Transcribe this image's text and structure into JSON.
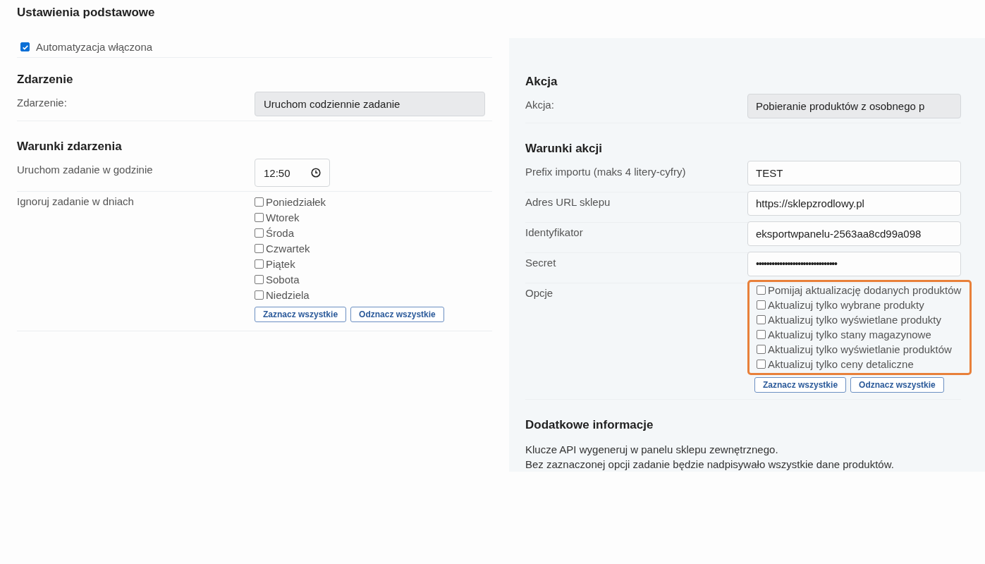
{
  "title": "Ustawienia podstawowe",
  "automation": {
    "label": "Automatyzacja włączona",
    "checked": true
  },
  "event": {
    "heading": "Zdarzenie",
    "label": "Zdarzenie:",
    "value": "Uruchom codziennie zadanie"
  },
  "event_conditions": {
    "heading": "Warunki zdarzenia",
    "time": {
      "label": "Uruchom zadanie w godzinie",
      "value": "12:50"
    },
    "ignore_days": {
      "label": "Ignoruj zadanie w dniach",
      "days": [
        {
          "label": "Poniedziałek",
          "checked": false
        },
        {
          "label": "Wtorek",
          "checked": false
        },
        {
          "label": "Środa",
          "checked": false
        },
        {
          "label": "Czwartek",
          "checked": false
        },
        {
          "label": "Piątek",
          "checked": false
        },
        {
          "label": "Sobota",
          "checked": false
        },
        {
          "label": "Niedziela",
          "checked": false
        }
      ],
      "buttons": [
        "Zaznacz wszystkie",
        "Odznacz wszystkie"
      ]
    }
  },
  "action": {
    "heading": "Akcja",
    "label": "Akcja:",
    "value": "Pobieranie produktów z osobnego p"
  },
  "action_conditions": {
    "heading": "Warunki akcji",
    "fields": [
      {
        "label": "Prefix importu (maks 4 litery-cyfry)",
        "value": "TEST"
      },
      {
        "label": "Adres URL sklepu",
        "value": "https://sklepzrodlowy.pl"
      },
      {
        "label": "Identyfikator",
        "value": "eksportwpanelu-2563aa8cd99a098"
      },
      {
        "label": "Secret",
        "value": "•••••••••••••••••••••••••••••••"
      }
    ],
    "options": {
      "label": "Opcje",
      "highlighted": true,
      "items": [
        {
          "label": "Pomijaj aktualizację dodanych produktów",
          "checked": false
        },
        {
          "label": "Aktualizuj tylko wybrane produkty",
          "checked": false
        },
        {
          "label": "Aktualizuj tylko wyświetlane produkty",
          "checked": false
        },
        {
          "label": "Aktualizuj tylko stany magazynowe",
          "checked": false
        },
        {
          "label": "Aktualizuj tylko wyświetlanie produktów",
          "checked": false
        },
        {
          "label": "Aktualizuj tylko ceny detaliczne",
          "checked": false
        }
      ],
      "buttons": [
        "Zaznacz wszystkie",
        "Odznacz wszystkie"
      ]
    }
  },
  "info": {
    "heading": "Dodatkowe informacje",
    "lines": [
      "Klucze API wygeneruj w panelu sklepu zewnętrznego.",
      "Bez zaznaczonej opcji zadanie będzie nadpisywało wszystkie dane produktów."
    ]
  }
}
